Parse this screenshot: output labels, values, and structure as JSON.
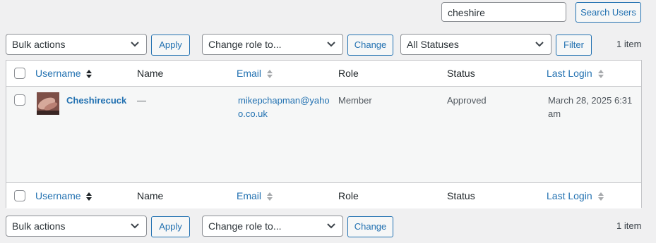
{
  "search": {
    "value": "cheshire",
    "button_label": "Search Users"
  },
  "top_nav": {
    "bulk_actions": "Bulk actions",
    "apply_label": "Apply",
    "change_role": "Change role to...",
    "change_label": "Change",
    "status_filter": "All Statuses",
    "filter_label": "Filter",
    "item_count": "1 item"
  },
  "columns": {
    "username": "Username",
    "name": "Name",
    "email": "Email",
    "role": "Role",
    "status": "Status",
    "last_login": "Last Login"
  },
  "users": [
    {
      "username": "Cheshirecuck",
      "name": "—",
      "email": "mikepchapman@yahoo.co.uk",
      "role": "Member",
      "status": "Approved",
      "last_login": "March 28, 2025 6:31 am"
    }
  ],
  "bottom_nav": {
    "bulk_actions": "Bulk actions",
    "apply_label": "Apply",
    "change_role": "Change role to...",
    "change_label": "Change",
    "item_count": "1 item"
  },
  "colors": {
    "accent": "#2271b1",
    "row_alt": "#f6f7f7",
    "border": "#c3c4c7"
  },
  "icons": [
    "chevron-down-icon",
    "sort-asc-icon",
    "sort-icon"
  ]
}
